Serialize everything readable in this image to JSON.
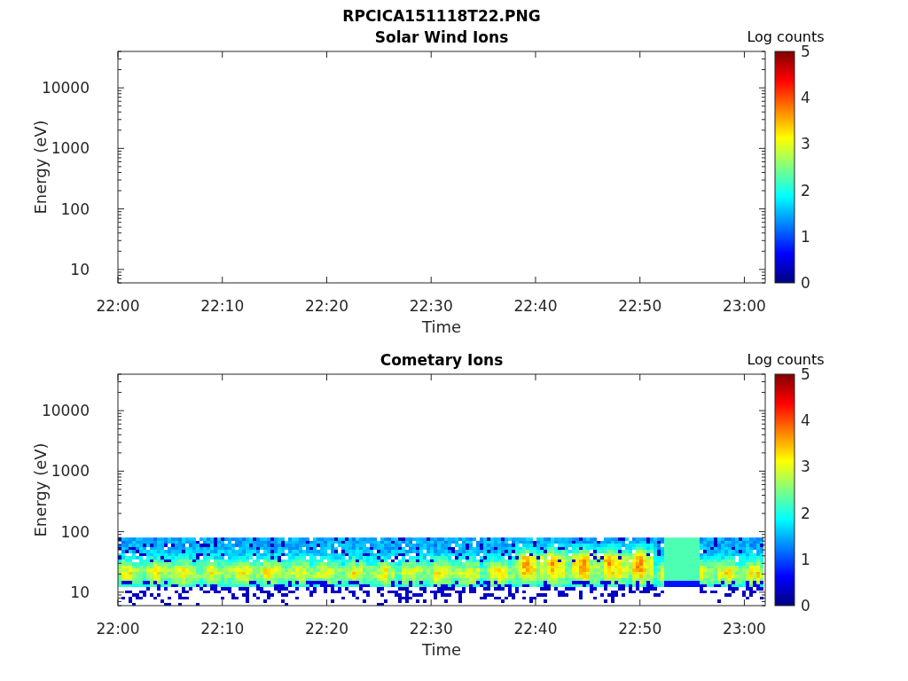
{
  "figure": {
    "title": "RPCICA151118T22.PNG"
  },
  "panels": [
    {
      "title": "Solar Wind Ions",
      "spectrogram": false,
      "xlabel": "Time",
      "ylabel": "Energy (eV)",
      "x_tick_labels": [
        "22:00",
        "22:10",
        "22:20",
        "22:30",
        "22:40",
        "22:50",
        "23:00"
      ],
      "y_tick_labels": [
        "10000",
        "1000",
        "100",
        "10"
      ],
      "colorbar": {
        "label": "Log counts",
        "ticks": [
          "5",
          "4",
          "3",
          "2",
          "1",
          "0"
        ]
      }
    },
    {
      "title": "Cometary Ions",
      "spectrogram": true,
      "xlabel": "Time",
      "ylabel": "Energy (eV)",
      "x_tick_labels": [
        "22:00",
        "22:10",
        "22:20",
        "22:30",
        "22:40",
        "22:50",
        "23:00"
      ],
      "y_tick_labels": [
        "10000",
        "1000",
        "100",
        "10"
      ],
      "colorbar": {
        "label": "Log counts",
        "ticks": [
          "5",
          "4",
          "3",
          "2",
          "1",
          "0"
        ]
      }
    }
  ]
}
